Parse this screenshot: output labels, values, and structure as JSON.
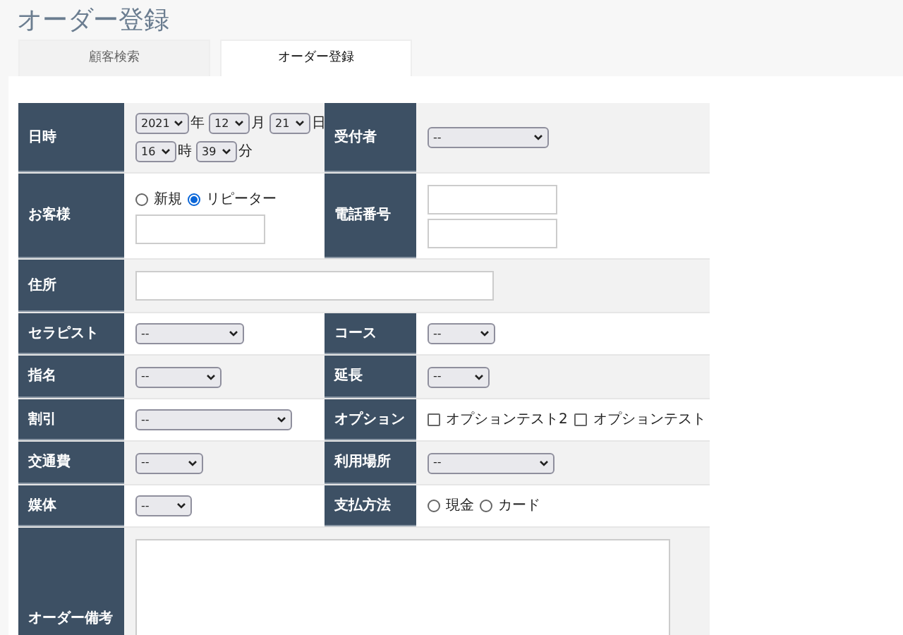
{
  "page_title": "オーダー登録",
  "tabs": [
    {
      "label": "顧客検索",
      "selected": false
    },
    {
      "label": "オーダー登録",
      "selected": true
    }
  ],
  "form_rows": [
    {
      "cells": [
        {
          "label": "日時",
          "kind": "datetime",
          "parts": [
            {
              "value": "2021",
              "unit": "年"
            },
            {
              "value": "12",
              "unit": "月"
            },
            {
              "value": "21",
              "unit": "日"
            },
            {
              "value": "16",
              "unit": "時"
            },
            {
              "value": "39",
              "unit": "分"
            }
          ]
        },
        {
          "label": "受付者",
          "kind": "select",
          "value": "--"
        }
      ]
    },
    {
      "cells": [
        {
          "label": "お客様",
          "kind": "radio_input",
          "options": [
            {
              "label": "新規",
              "selected": false
            },
            {
              "label": "リピーター",
              "selected": true
            }
          ]
        },
        {
          "label": "電話番号",
          "kind": "double_input"
        }
      ]
    },
    {
      "cells": [
        {
          "label": "住所",
          "kind": "input"
        }
      ]
    },
    {
      "cells": [
        {
          "label": "セラピスト",
          "kind": "select",
          "value": "--"
        },
        {
          "label": "コース",
          "kind": "select",
          "value": "--"
        }
      ]
    },
    {
      "cells": [
        {
          "label": "指名",
          "kind": "select",
          "value": "--"
        },
        {
          "label": "延長",
          "kind": "select",
          "value": "--"
        }
      ]
    },
    {
      "cells": [
        {
          "label": "割引",
          "kind": "select",
          "value": "--"
        },
        {
          "label": "オプション",
          "kind": "checkboxes",
          "options": [
            {
              "label": "オプションテスト2",
              "checked": false
            },
            {
              "label": "オプションテスト",
              "checked": false
            }
          ]
        }
      ]
    },
    {
      "cells": [
        {
          "label": "交通費",
          "kind": "select",
          "value": "--"
        },
        {
          "label": "利用場所",
          "kind": "select",
          "value": "--"
        }
      ]
    },
    {
      "cells": [
        {
          "label": "媒体",
          "kind": "select",
          "value": "--"
        },
        {
          "label": "支払方法",
          "kind": "radio",
          "options": [
            {
              "label": "現金",
              "selected": false
            },
            {
              "label": "カード",
              "selected": false
            }
          ]
        }
      ]
    },
    {
      "cells": [
        {
          "label": "オーダー備考",
          "kind": "textarea"
        }
      ]
    }
  ]
}
